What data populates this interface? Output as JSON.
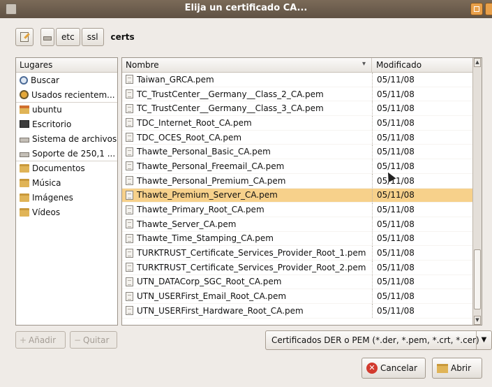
{
  "window": {
    "title": "Elija un certificado CA..."
  },
  "pathbar": {
    "segments": [
      "etc",
      "ssl",
      "certs"
    ]
  },
  "places": {
    "header": "Lugares",
    "items": [
      {
        "label": "Buscar",
        "icon": "search-icon"
      },
      {
        "label": "Usados recientem...",
        "icon": "recent-icon"
      },
      {
        "label": "ubuntu",
        "icon": "home-folder-icon"
      },
      {
        "label": "Escritorio",
        "icon": "desktop-icon"
      },
      {
        "label": "Sistema de archivos",
        "icon": "drive-icon"
      },
      {
        "label": "Soporte de 250,1 ...",
        "icon": "drive-icon"
      },
      {
        "label": "Documentos",
        "icon": "folder-icon"
      },
      {
        "label": "Música",
        "icon": "folder-icon"
      },
      {
        "label": "Imágenes",
        "icon": "folder-icon"
      },
      {
        "label": "Vídeos",
        "icon": "folder-icon"
      }
    ],
    "add_label": "Añadir",
    "remove_label": "Quitar"
  },
  "files": {
    "col_name": "Nombre",
    "col_modified": "Modificado",
    "selected_index": 8,
    "rows": [
      {
        "name": "Taiwan_GRCA.pem",
        "date": "05/11/08"
      },
      {
        "name": "TC_TrustCenter__Germany__Class_2_CA.pem",
        "date": "05/11/08"
      },
      {
        "name": "TC_TrustCenter__Germany__Class_3_CA.pem",
        "date": "05/11/08"
      },
      {
        "name": "TDC_Internet_Root_CA.pem",
        "date": "05/11/08"
      },
      {
        "name": "TDC_OCES_Root_CA.pem",
        "date": "05/11/08"
      },
      {
        "name": "Thawte_Personal_Basic_CA.pem",
        "date": "05/11/08"
      },
      {
        "name": "Thawte_Personal_Freemail_CA.pem",
        "date": "05/11/08"
      },
      {
        "name": "Thawte_Personal_Premium_CA.pem",
        "date": "05/11/08"
      },
      {
        "name": "Thawte_Premium_Server_CA.pem",
        "date": "05/11/08"
      },
      {
        "name": "Thawte_Primary_Root_CA.pem",
        "date": "05/11/08"
      },
      {
        "name": "Thawte_Server_CA.pem",
        "date": "05/11/08"
      },
      {
        "name": "Thawte_Time_Stamping_CA.pem",
        "date": "05/11/08"
      },
      {
        "name": "TURKTRUST_Certificate_Services_Provider_Root_1.pem",
        "date": "05/11/08"
      },
      {
        "name": "TURKTRUST_Certificate_Services_Provider_Root_2.pem",
        "date": "05/11/08"
      },
      {
        "name": "UTN_DATACorp_SGC_Root_CA.pem",
        "date": "05/11/08"
      },
      {
        "name": "UTN_USERFirst_Email_Root_CA.pem",
        "date": "05/11/08"
      },
      {
        "name": "UTN_USERFirst_Hardware_Root_CA.pem",
        "date": "05/11/08"
      }
    ]
  },
  "filter": {
    "selected": "Certificados DER o PEM (*.der, *.pem, *.crt, *.cer)"
  },
  "buttons": {
    "cancel": "Cancelar",
    "open": "Abrir"
  },
  "colors": {
    "selection": "#f7d18b",
    "titlebar": "#6b5c4c",
    "background": "#efebe7"
  }
}
